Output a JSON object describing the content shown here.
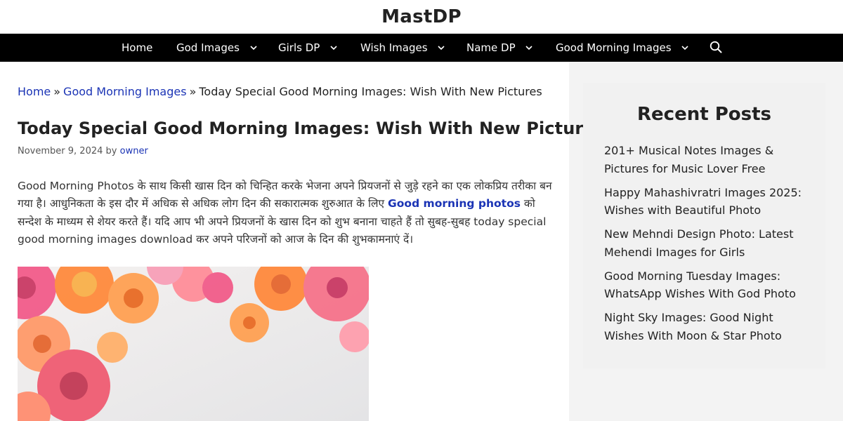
{
  "site": {
    "title": "MastDP"
  },
  "nav": {
    "items": [
      {
        "label": "Home",
        "has_dropdown": false
      },
      {
        "label": "God Images",
        "has_dropdown": true
      },
      {
        "label": "Girls DP",
        "has_dropdown": true
      },
      {
        "label": "Wish Images",
        "has_dropdown": true
      },
      {
        "label": "Name DP",
        "has_dropdown": true
      },
      {
        "label": "Good Morning Images",
        "has_dropdown": true
      }
    ],
    "search_icon": "search-icon"
  },
  "breadcrumb": {
    "home": "Home",
    "category": "Good Morning Images",
    "current": "Today Special Good Morning Images: Wish With New Pictures",
    "separator": "»"
  },
  "post": {
    "title": "Today Special Good Morning Images: Wish With New Pictures",
    "date": "November 9, 2024",
    "by": "by",
    "author": "owner",
    "body_part1": "Good Morning Photos के साथ किसी खास दिन को चिन्हित करके भेजना अपने प्रियजनों से जुड़े रहने का एक लोकप्रिय तरीका बन गया है। आधुनिकता के इस दौर में अधिक से अधिक लोग दिन की सकारात्मक शुरुआत के लिए",
    "body_link": "Good morning photos",
    "body_part2": "को सन्देश के माध्यम से शेयर करते हैं। यदि आप भी अपने प्रियजनों के खास दिन को शुभ बनाना चाहते हैं तो सुबह-सुबह today special good morning images download कर अपने परिजनों को आज के दिन की शुभकामनाएं दें।"
  },
  "sidebar": {
    "widget_title": "Recent Posts",
    "recent_posts": [
      "201+ Musical Notes Images & Pictures for Music Lover Free",
      "Happy Mahashivratri Images 2025: Wishes with Beautiful Photo",
      "New Mehndi Design Photo: Latest Mehendi Images for Girls",
      "Good Morning Tuesday Images: WhatsApp Wishes With God Photo",
      "Night Sky Images: Good Night Wishes With Moon & Star Photo"
    ]
  },
  "colors": {
    "nav_bg": "#000000",
    "link": "#1b34b5",
    "sidebar_bg": "#f1f1f1",
    "page_bg": "#f3f3f3"
  }
}
